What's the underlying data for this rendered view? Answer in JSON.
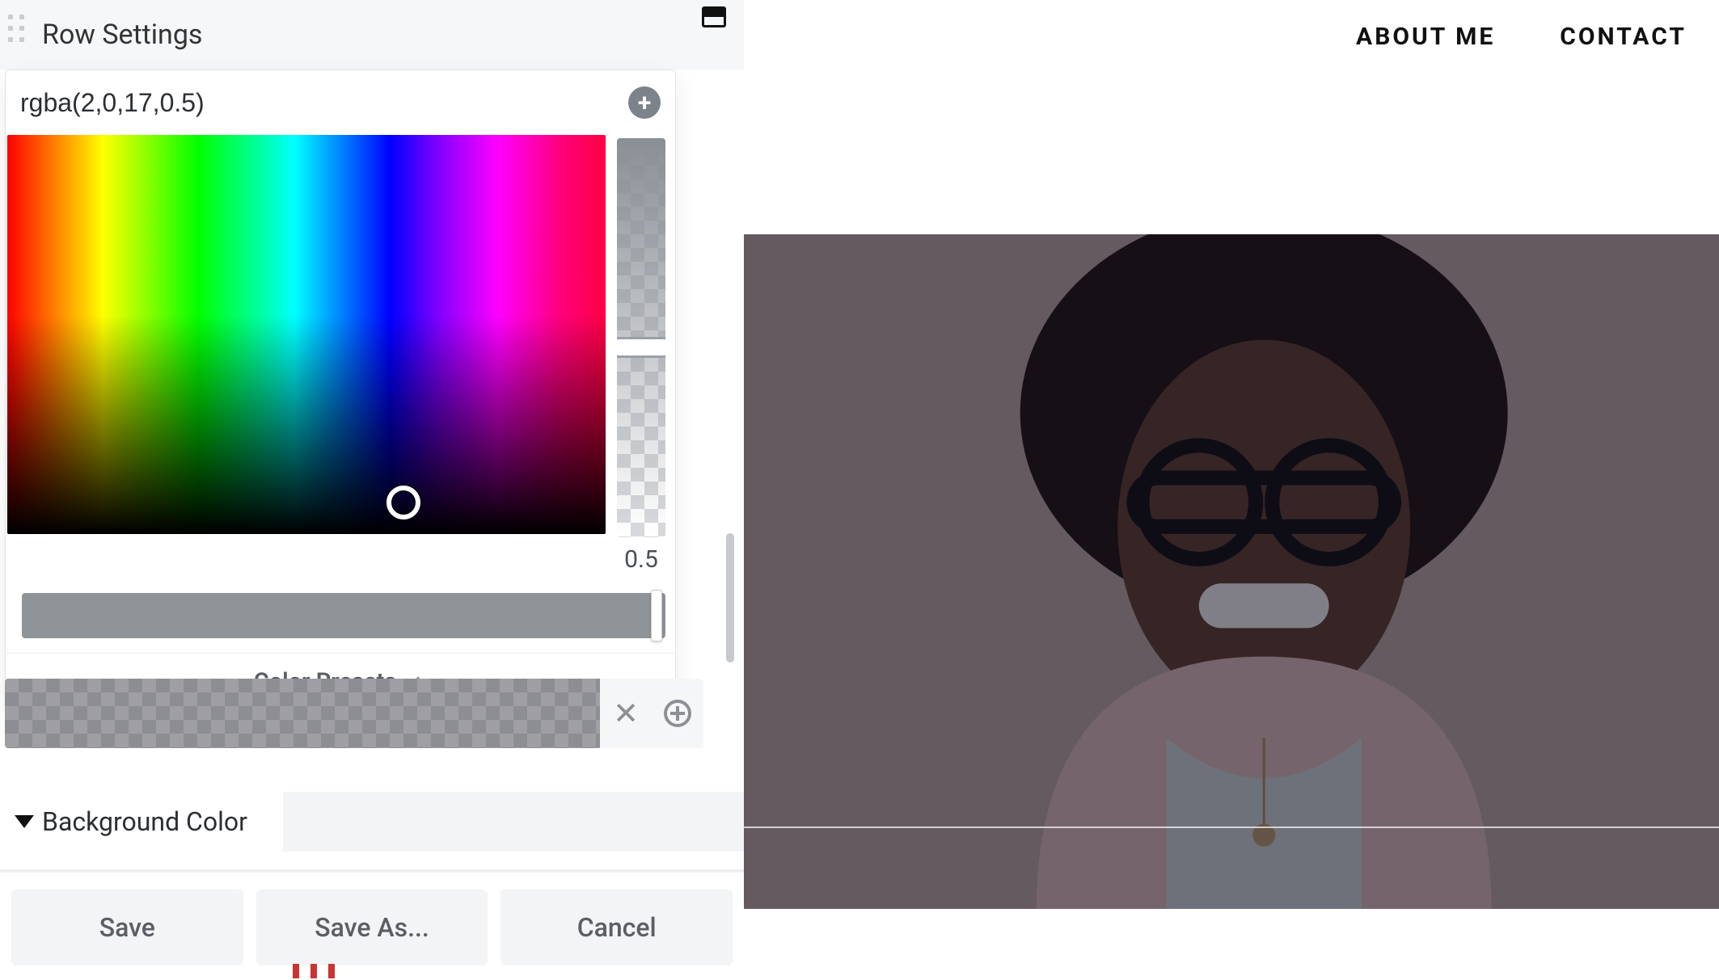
{
  "nav": {
    "about": "ABOUT ME",
    "contact": "CONTACT"
  },
  "panel": {
    "title": "Row Settings"
  },
  "picker": {
    "value": "rgba(2,0,17,0.5)",
    "alpha": "0.5",
    "presets_label": "Color Presets"
  },
  "bg_section": {
    "label": "Background Color"
  },
  "footer": {
    "save": "Save",
    "save_as": "Save As...",
    "cancel": "Cancel"
  }
}
